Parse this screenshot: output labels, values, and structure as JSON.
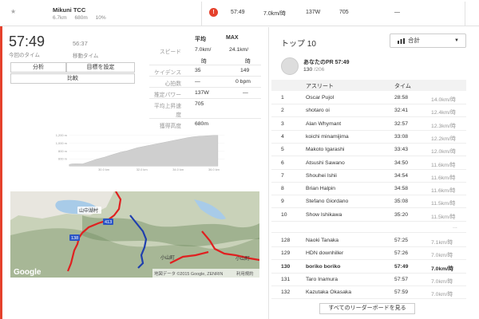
{
  "segment": {
    "name": "Mikuni TCC",
    "distance": "6.7km",
    "elevation": "680m",
    "grade": "10%"
  },
  "effort": {
    "alert_count": "!",
    "time": "57:49",
    "speed": "7.0km/時",
    "power": "137W",
    "value": "705",
    "dash": "—"
  },
  "summary": {
    "elapsed_time": "57:49",
    "elapsed_label": "今回のタイム",
    "moving_time": "56:37",
    "moving_label": "移動タイム"
  },
  "buttons": {
    "analysis": "分析",
    "set_target": "目標を設定",
    "compare": "比較"
  },
  "stats": {
    "col_avg": "平均",
    "col_max": "MAX",
    "rows": [
      {
        "label": "スピード",
        "avg": "7.0km/",
        "max": "24.1km/"
      },
      {
        "label": "",
        "avg": "時",
        "max": "時"
      },
      {
        "label": "ケイデンス",
        "avg": "35",
        "max": "149"
      },
      {
        "label": "心拍数",
        "avg": "—",
        "max": "0 bpm"
      },
      {
        "label": "推定パワー",
        "avg": "137W",
        "max": "—"
      },
      {
        "label": "平均上昇速",
        "avg": "705",
        "max": ""
      },
      {
        "label": "度",
        "avg": "",
        "max": ""
      },
      {
        "label": "獲得高度",
        "avg": "680m",
        "max": ""
      }
    ]
  },
  "elevation_chart": {
    "y_ticks": [
      "1,200 m",
      "1,000 m",
      "800 m",
      "600 m"
    ],
    "x_ticks": [
      "30.0 km",
      "32.0 km",
      "34.0 km",
      "36.0 km"
    ]
  },
  "map": {
    "place1": "山中湖村",
    "route1": "413",
    "route2": "138",
    "place2": "小山町",
    "place3": "小山町",
    "logo": "Google",
    "attribution": "地図データ ©2015 Google, ZENRIN",
    "terms": "利用規約"
  },
  "leaderboard": {
    "title": "トップ 10",
    "filter": "合計",
    "pr_title": "あなたのPR 57:49",
    "pr_rank": "130",
    "pr_total": "/206",
    "col_athlete": "アスリート",
    "col_time": "タイム",
    "rows": [
      {
        "rank": "1",
        "name": "Oscar Pujol",
        "time": "28:58",
        "speed": "14.0km/時"
      },
      {
        "rank": "2",
        "name": "shotaro oi",
        "time": "32:41",
        "speed": "12.4km/時"
      },
      {
        "rank": "3",
        "name": "Alan Whymant",
        "time": "32:57",
        "speed": "12.3km/時"
      },
      {
        "rank": "4",
        "name": "koichi minamijima",
        "time": "33:08",
        "speed": "12.2km/時"
      },
      {
        "rank": "5",
        "name": "Makoto Igarashi",
        "time": "33:43",
        "speed": "12.0km/時"
      },
      {
        "rank": "6",
        "name": "Atsushi Sawano",
        "time": "34:50",
        "speed": "11.6km/時"
      },
      {
        "rank": "7",
        "name": "Shouhei Ishii",
        "time": "34:54",
        "speed": "11.6km/時"
      },
      {
        "rank": "8",
        "name": "Brian Halpin",
        "time": "34:58",
        "speed": "11.6km/時"
      },
      {
        "rank": "9",
        "name": "Stefano Giordano",
        "time": "35:08",
        "speed": "11.5km/時"
      },
      {
        "rank": "10",
        "name": "Show Ishikawa",
        "time": "35:20",
        "speed": "11.5km/時"
      }
    ],
    "gap": "...",
    "rows2": [
      {
        "rank": "128",
        "name": "Naoki Tanaka",
        "time": "57:25",
        "speed": "7.1km/時"
      },
      {
        "rank": "129",
        "name": "HDN downhiller",
        "time": "57:26",
        "speed": "7.0km/時"
      },
      {
        "rank": "130",
        "name": "boriko boriko",
        "time": "57:49",
        "speed": "7.0km/時"
      },
      {
        "rank": "131",
        "name": "Taro Inamura",
        "time": "57:57",
        "speed": "7.0km/時"
      },
      {
        "rank": "132",
        "name": "Kazutaka Okasaka",
        "time": "57:59",
        "speed": "7.0km/時"
      }
    ],
    "view_all": "すべてのリーダーボードを見る"
  },
  "colors": {
    "accent": "#e5412c",
    "route_red": "#e02020",
    "route_blue": "#1f3fae"
  }
}
